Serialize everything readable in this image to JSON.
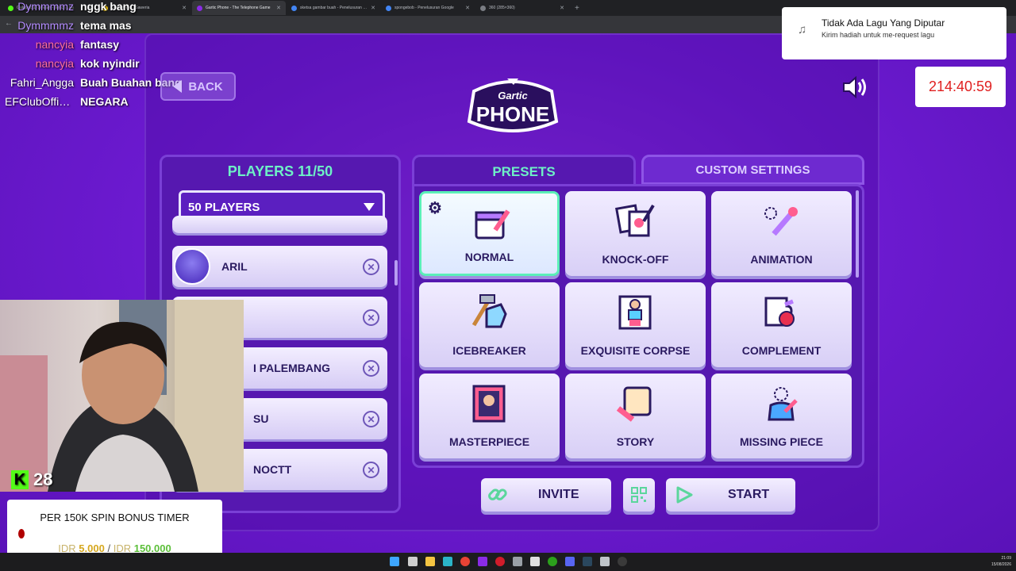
{
  "browser": {
    "tabs": [
      {
        "title": "GulapaitXD Stream - Watch Live",
        "active": false
      },
      {
        "title": "Overlay-mu - Saweria",
        "active": false
      },
      {
        "title": "Gartic Phone - The Telephone Game",
        "active": true
      },
      {
        "title": "sketsa gambar buah - Penelusuran Google",
        "active": false
      },
      {
        "title": "spongebob - Penelusuran Google",
        "active": false
      },
      {
        "title": "360 (285×360)",
        "active": false
      }
    ],
    "new_tab_symbol": "+"
  },
  "chat": [
    {
      "user": "Dymmmmz",
      "message": "nggk bang",
      "color": "#b48cff"
    },
    {
      "user": "Dymmmmz",
      "message": "tema mas",
      "color": "#b48cff"
    },
    {
      "user": "nancyia",
      "message": "fantasy",
      "color": "#ff6f9c"
    },
    {
      "user": "nancyia",
      "message": "kok nyindir",
      "color": "#ff6f9c"
    },
    {
      "user": "Fahri_Angga",
      "message": "Buah Buahan bang",
      "color": "#ffffff"
    },
    {
      "user": "EFClubOffici...",
      "message": "NEGARA",
      "color": "#ffffff"
    }
  ],
  "game": {
    "back_label": "BACK",
    "logo_line1": "Gartic",
    "logo_line2": "PHONE",
    "players": {
      "title": "PLAYERS 11/50",
      "limit_selected": "50 PLAYERS",
      "list": [
        {
          "name": "ARIL"
        },
        {
          "name": ""
        },
        {
          "name": "I PALEMBANG"
        },
        {
          "name": "SU"
        },
        {
          "name": "NOCTT"
        }
      ]
    },
    "tabs": {
      "presets": "PRESETS",
      "custom": "CUSTOM SETTINGS"
    },
    "presets": [
      {
        "label": "NORMAL",
        "icon": "calendar-pencil-icon",
        "selected": true
      },
      {
        "label": "KNOCK-OFF",
        "icon": "cards-pencil-icon",
        "selected": false
      },
      {
        "label": "ANIMATION",
        "icon": "motion-pencil-icon",
        "selected": false
      },
      {
        "label": "ICEBREAKER",
        "icon": "ice-hammer-icon",
        "selected": false
      },
      {
        "label": "EXQUISITE CORPSE",
        "icon": "corpse-drawing-icon",
        "selected": false
      },
      {
        "label": "COMPLEMENT",
        "icon": "puzzle-apple-icon",
        "selected": false
      },
      {
        "label": "MASTERPIECE",
        "icon": "framed-painting-icon",
        "selected": false
      },
      {
        "label": "STORY",
        "icon": "scroll-quill-icon",
        "selected": false
      },
      {
        "label": "MISSING PIECE",
        "icon": "missing-head-icon",
        "selected": false
      }
    ],
    "buttons": {
      "invite": "INVITE",
      "start": "START"
    }
  },
  "overlay": {
    "viewer_count": "28",
    "kick_badge": "K",
    "spin": {
      "title": "PER 150K SPIN BONUS TIMER",
      "currency": "IDR",
      "current": "5.000",
      "separator": "/",
      "target": "150.000"
    },
    "song": {
      "title": "Tidak Ada Lagu Yang Diputar",
      "subtitle": "Kirim hadiah untuk me-request lagu"
    },
    "timer": "214:40:59"
  },
  "taskbar": {
    "time": "21:09",
    "date": "15/08/2026"
  },
  "colors": {
    "accent_mint": "#6ef0c6",
    "panel_purple": "#5618b0",
    "background_purple": "#6e1bd3",
    "timer_red": "#e02020"
  }
}
